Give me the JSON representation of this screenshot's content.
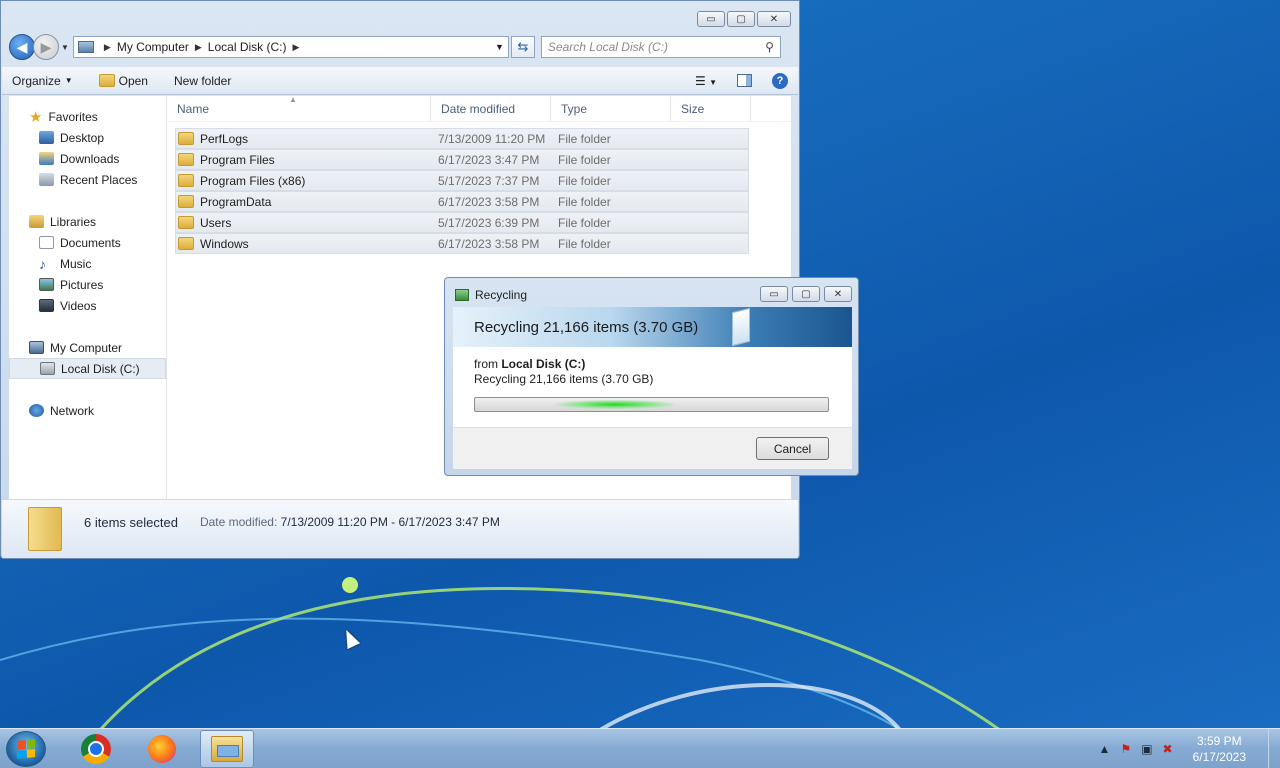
{
  "explorer": {
    "window_controls": {
      "minimize": "▭",
      "maximize": "▢",
      "close": "✕"
    },
    "address": {
      "crumbs": [
        "My Computer",
        "Local Disk (C:)"
      ]
    },
    "search_placeholder": "Search Local Disk (C:)",
    "toolbar": {
      "organize": "Organize",
      "open": "Open",
      "new_folder": "New folder"
    },
    "nav": {
      "favorites": "Favorites",
      "desktop": "Desktop",
      "downloads": "Downloads",
      "recent_places": "Recent Places",
      "libraries": "Libraries",
      "documents": "Documents",
      "music": "Music",
      "pictures": "Pictures",
      "videos": "Videos",
      "my_computer": "My Computer",
      "local_disk": "Local Disk (C:)",
      "network": "Network"
    },
    "columns": {
      "name": "Name",
      "date": "Date modified",
      "type": "Type",
      "size": "Size"
    },
    "files": [
      {
        "name": "PerfLogs",
        "date": "7/13/2009 11:20 PM",
        "type": "File folder"
      },
      {
        "name": "Program Files",
        "date": "6/17/2023 3:47 PM",
        "type": "File folder"
      },
      {
        "name": "Program Files (x86)",
        "date": "5/17/2023 7:37 PM",
        "type": "File folder"
      },
      {
        "name": "ProgramData",
        "date": "6/17/2023 3:58 PM",
        "type": "File folder"
      },
      {
        "name": "Users",
        "date": "5/17/2023 6:39 PM",
        "type": "File folder"
      },
      {
        "name": "Windows",
        "date": "6/17/2023 3:58 PM",
        "type": "File folder"
      }
    ],
    "details": {
      "count": "6 items selected",
      "date_label": "Date modified:",
      "date_range": "7/13/2009 11:20 PM - 6/17/2023 3:47 PM"
    }
  },
  "dialog": {
    "title": "Recycling",
    "banner": "Recycling 21,166 items (3.70 GB)",
    "from_label": "from",
    "from_value": "Local Disk (C:)",
    "status": "Recycling 21,166 items (3.70 GB)",
    "progress_state": "indeterminate",
    "cancel": "Cancel"
  },
  "taskbar": {
    "apps": [
      "start-icon",
      "chrome-icon",
      "firefox-icon",
      "explorer-icon"
    ],
    "tray_icons": [
      "show-hidden-icon",
      "flag-icon",
      "network-icon",
      "volume-muted-icon"
    ],
    "time": "3:59 PM",
    "date": "6/17/2023"
  }
}
